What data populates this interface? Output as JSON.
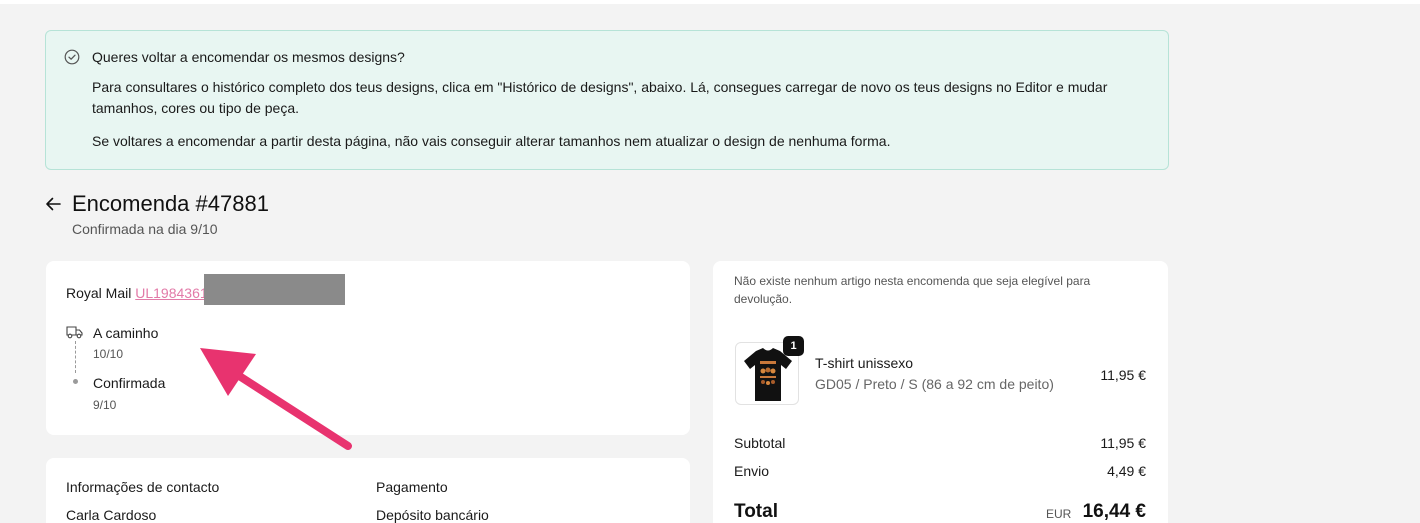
{
  "notice": {
    "icon": "check-circle-icon",
    "title": "Queres voltar a encomendar os mesmos designs?",
    "paragraph1": "Para consultares o histórico completo dos teus designs, clica em \"Histórico de designs\", abaixo. Lá, consegues carregar de novo os teus designs no Editor e mudar tamanhos, cores ou tipo de peça.",
    "paragraph2": "Se voltares a encomendar a partir desta página, não vais conseguir alterar tamanhos nem atualizar o design de nenhuma forma."
  },
  "order": {
    "back_icon": "arrow-left-icon",
    "title": "Encomenda #47881",
    "subtitle": "Confirmada na dia 9/10"
  },
  "tracking": {
    "carrier": "Royal Mail",
    "tracking_number": "UL1984361",
    "events": [
      {
        "icon": "truck-icon",
        "status": "A caminho",
        "date": "10/10"
      },
      {
        "icon": "dot-icon",
        "status": "Confirmada",
        "date": "9/10"
      }
    ]
  },
  "contact": {
    "contact_label": "Informações de contacto",
    "contact_name": "Carla Cardoso",
    "payment_label": "Pagamento",
    "payment_method": "Depósito bancário"
  },
  "summary": {
    "return_note": "Não existe nenhum artigo nesta encomenda que seja elegível para devolução.",
    "item": {
      "quantity": "1",
      "name": "T-shirt unissexo",
      "variant": "GD05 / Preto / S (86 a 92 cm de peito)",
      "price": "11,95 €"
    },
    "subtotal_label": "Subtotal",
    "subtotal_value": "11,95 €",
    "shipping_label": "Envio",
    "shipping_value": "4,49 €",
    "total_label": "Total",
    "currency": "EUR",
    "total_value": "16,44 €"
  },
  "colors": {
    "notice_bg": "#e8f6f2",
    "link": "#e27aa8",
    "annotation_arrow": "#e8336f"
  }
}
